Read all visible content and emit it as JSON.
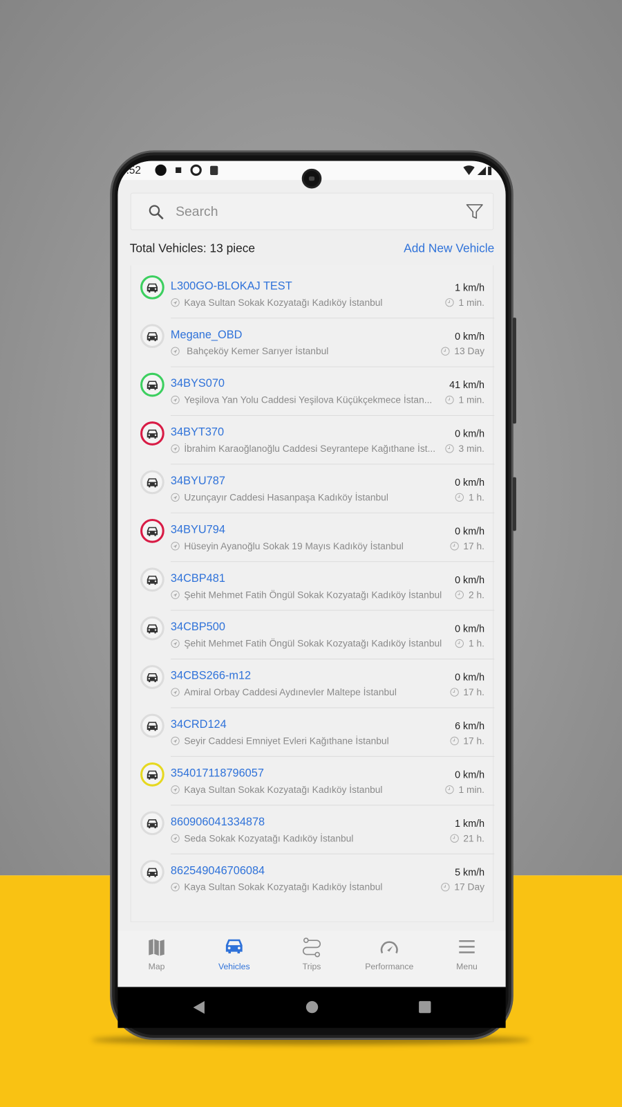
{
  "status_bar": {
    "time": ":52"
  },
  "search": {
    "placeholder": "Search",
    "icon": "search-icon",
    "filter_icon": "filter-icon"
  },
  "summary": {
    "total": "Total Vehicles: 13 piece",
    "add_label": "Add New Vehicle"
  },
  "colors": {
    "accent": "#2f72d9",
    "status_green": "#3ccf5f",
    "status_red": "#d81b45",
    "status_gray": "#dcdcdc",
    "status_yellow": "#e6d820",
    "background_yellow": "#f9c213"
  },
  "vehicles": [
    {
      "name": "L300GO-BLOKAJ TEST",
      "address": "Kaya Sultan Sokak Kozyatağı Kadıköy İstanbul",
      "speed": "1 km/h",
      "ago": "1 min.",
      "status": "green"
    },
    {
      "name": "Megane_OBD",
      "address": " Bahçeköy Kemer Sarıyer İstanbul",
      "speed": "0 km/h",
      "ago": "13 Day",
      "status": "gray"
    },
    {
      "name": "34BYS070",
      "address": "Yeşilova Yan Yolu Caddesi Yeşilova Küçükçekmece İstan...",
      "speed": "41 km/h",
      "ago": "1 min.",
      "status": "green"
    },
    {
      "name": "34BYT370",
      "address": "İbrahim Karaoğlanoğlu Caddesi Seyrantepe Kağıthane İst...",
      "speed": "0 km/h",
      "ago": "3 min.",
      "status": "red"
    },
    {
      "name": "34BYU787",
      "address": "Uzunçayır Caddesi Hasanpaşa Kadıköy İstanbul",
      "speed": "0 km/h",
      "ago": "1 h.",
      "status": "gray"
    },
    {
      "name": "34BYU794",
      "address": "Hüseyin Ayanoğlu Sokak 19 Mayıs Kadıköy İstanbul",
      "speed": "0 km/h",
      "ago": "17 h.",
      "status": "red"
    },
    {
      "name": "34CBP481",
      "address": "Şehit Mehmet Fatih Öngül Sokak Kozyatağı Kadıköy İstanbul",
      "speed": "0 km/h",
      "ago": "2 h.",
      "status": "gray"
    },
    {
      "name": "34CBP500",
      "address": "Şehit Mehmet Fatih Öngül Sokak Kozyatağı Kadıköy İstanbul",
      "speed": "0 km/h",
      "ago": "1 h.",
      "status": "gray"
    },
    {
      "name": "34CBS266-m12",
      "address": "Amiral Orbay Caddesi Aydınevler Maltepe İstanbul",
      "speed": "0 km/h",
      "ago": "17 h.",
      "status": "gray"
    },
    {
      "name": "34CRD124",
      "address": "Seyir Caddesi Emniyet Evleri Kağıthane İstanbul",
      "speed": "6 km/h",
      "ago": "17 h.",
      "status": "gray"
    },
    {
      "name": "354017118796057",
      "address": "Kaya Sultan Sokak Kozyatağı Kadıköy İstanbul",
      "speed": "0 km/h",
      "ago": "1 min.",
      "status": "yellow"
    },
    {
      "name": "860906041334878",
      "address": "Seda Sokak Kozyatağı Kadıköy İstanbul",
      "speed": "1 km/h",
      "ago": "21 h.",
      "status": "gray"
    },
    {
      "name": "862549046706084",
      "address": "Kaya Sultan Sokak Kozyatağı Kadıköy İstanbul",
      "speed": "5 km/h",
      "ago": "17 Day",
      "status": "gray"
    }
  ],
  "bottom_nav": [
    {
      "label": "Map",
      "icon": "map-icon",
      "active": false
    },
    {
      "label": "Vehicles",
      "icon": "car-icon",
      "active": true
    },
    {
      "label": "Trips",
      "icon": "route-icon",
      "active": false
    },
    {
      "label": "Performance",
      "icon": "speedometer-icon",
      "active": false
    },
    {
      "label": "Menu",
      "icon": "hamburger-icon",
      "active": false
    }
  ]
}
